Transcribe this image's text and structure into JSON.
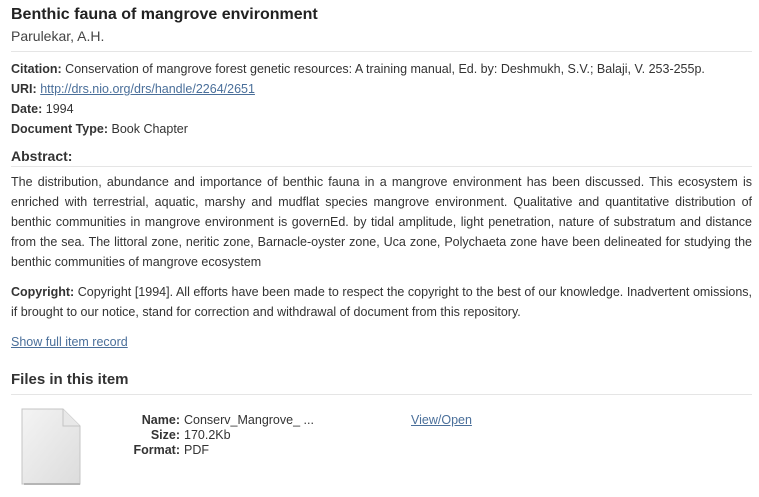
{
  "item": {
    "title": "Benthic fauna of mangrove environment",
    "author": "Parulekar, A.H."
  },
  "metadata": {
    "citation_label": "Citation:",
    "citation_value": "Conservation of mangrove forest genetic resources: A training manual, Ed. by: Deshmukh, S.V.; Balaji, V. 253-255p.",
    "uri_label": "URI:",
    "uri_value": "http://drs.nio.org/drs/handle/2264/2651",
    "date_label": "Date:",
    "date_value": "1994",
    "type_label": "Document Type:",
    "type_value": "Book Chapter"
  },
  "abstract": {
    "heading": "Abstract:",
    "text": "The distribution, abundance and importance of benthic fauna in a mangrove environment has been discussed. This ecosystem is enriched with terrestrial, aquatic, marshy and mudflat species mangrove environment. Qualitative and quantitative distribution of benthic communities in mangrove environment is governEd. by tidal amplitude, light penetration, nature of substratum and distance from the sea. The littoral zone, neritic zone, Barnacle-oyster zone, Uca zone, Polychaeta zone have been delineated for studying the benthic communities of mangrove ecosystem"
  },
  "copyright": {
    "label": "Copyright:",
    "text": "Copyright [1994]. All efforts have been made to respect the copyright to the best of our knowledge. Inadvertent omissions, if brought to our notice, stand for correction and withdrawal of document from this repository."
  },
  "links": {
    "full_record": "Show full item record"
  },
  "files": {
    "heading": "Files in this item",
    "items": [
      {
        "name_label": "Name:",
        "name_value": "Conserv_Mangrove_ ...",
        "size_label": "Size:",
        "size_value": "170.2Kb",
        "format_label": "Format:",
        "format_value": "PDF",
        "view_label": "View/Open",
        "icon": "file-icon"
      }
    ]
  }
}
